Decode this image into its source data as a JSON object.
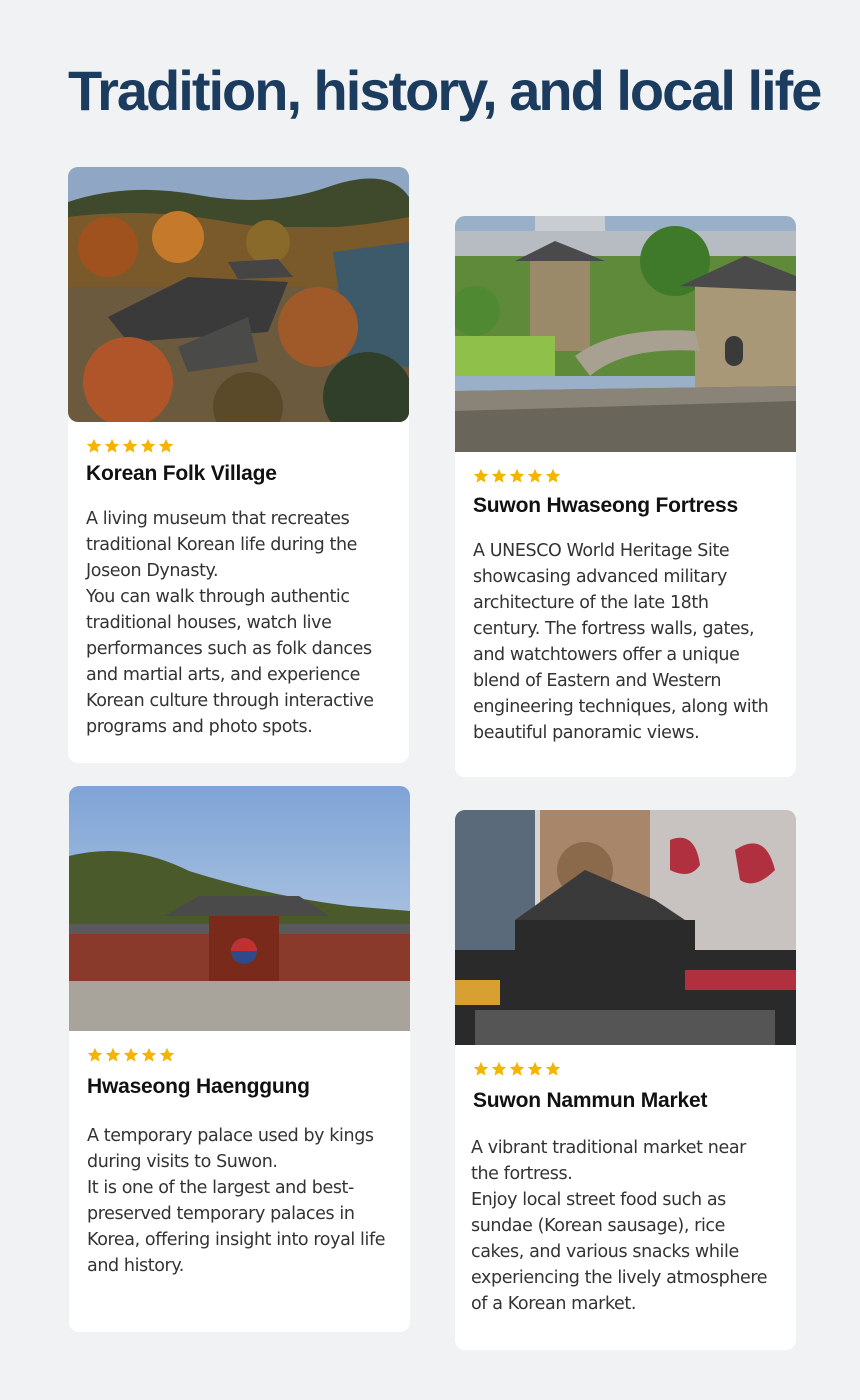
{
  "page": {
    "title": "Tradition, history, and local life"
  },
  "colors": {
    "title": "#1b3c5e",
    "star": "#f5b400",
    "background": "#f1f2f4",
    "card": "#ffffff"
  },
  "cards": [
    {
      "name": "Korean Folk Village",
      "rating": 5,
      "image_icon": "folk-village-photo",
      "description": [
        "A living museum that recreates traditional Korean life during the Joseon Dynasty.",
        "You can walk through authentic traditional houses, watch live performances such as folk dances and martial arts, and experience Korean culture through interactive programs and photo spots."
      ]
    },
    {
      "name": "Suwon Hwaseong Fortress",
      "rating": 5,
      "image_icon": "fortress-photo",
      "description": [
        "A UNESCO World Heritage Site showcasing advanced military architecture of the late 18th century. The fortress walls, gates, and watchtowers offer a unique blend of Eastern and Western engineering techniques, along with beautiful panoramic views."
      ]
    },
    {
      "name": "Hwaseong Haenggung",
      "rating": 5,
      "image_icon": "palace-photo",
      "description": [
        "A temporary palace used by kings during visits to Suwon.",
        "It is one of the largest and best-preserved temporary palaces in Korea, offering insight into royal life and history."
      ]
    },
    {
      "name": "Suwon Nammun Market",
      "rating": 5,
      "image_icon": "market-photo",
      "description": [
        "A vibrant traditional market near the fortress.",
        "Enjoy local street food such as sundae (Korean sausage), rice cakes, and various snacks while experiencing the lively atmosphere of a Korean market."
      ]
    }
  ]
}
